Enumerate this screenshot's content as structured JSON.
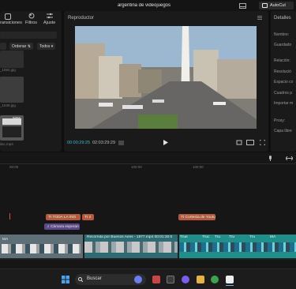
{
  "window": {
    "title": "argentina de videojuegos",
    "autocut_label": "AutoCut"
  },
  "media_panel": {
    "tools": [
      {
        "label": "ransiciones",
        "icon": "transitions-icon"
      },
      {
        "label": "Filtros",
        "icon": "filters-icon"
      },
      {
        "label": "Ajuste",
        "icon": "adjust-icon"
      }
    ],
    "sort_label": "Ordenar",
    "filter_label": "Todos",
    "files": [
      {
        "name": "_1592.jpg"
      },
      {
        "name": "_1539.jpg",
        "duration": ""
      },
      {
        "name": "ilac.mp4",
        "duration": "5656"
      }
    ]
  },
  "player": {
    "header": "Reproductor",
    "current_time": "00:00:29:25",
    "total_time": "02:03:29:29"
  },
  "details": {
    "header": "Detalles",
    "labels": [
      "Nombre:",
      "Guardado",
      "Relación:",
      "Resolució",
      "Espacio co",
      "Cuadros p",
      "Importar m",
      "Proxy:",
      "Capa libre"
    ]
  },
  "timeline": {
    "ruler": [
      "00:00",
      "100:00",
      "100:00"
    ],
    "text_clips": [
      "TODA LA INO",
      "2",
      "Cortesía de Youtu"
    ],
    "audio_clip": "Cámara esperan",
    "video_clips": [
      "MA",
      "Recorrida por Buenos Aires - 1977.mp4  00:01:30:0",
      "True",
      "Truc",
      "Tru",
      "Tru",
      "Tru",
      "MA"
    ]
  },
  "taskbar": {
    "search_placeholder": "Buscar"
  }
}
